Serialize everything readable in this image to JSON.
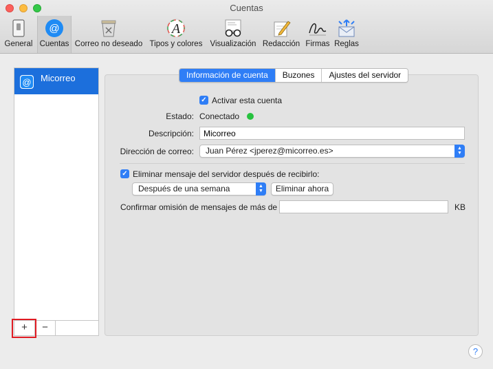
{
  "window": {
    "title": "Cuentas"
  },
  "toolbar": {
    "items": [
      {
        "label": "General",
        "icon": "general-switch-icon"
      },
      {
        "label": "Cuentas",
        "icon": "at-sign-icon"
      },
      {
        "label": "Correo no deseado",
        "icon": "junk-trash-icon"
      },
      {
        "label": "Tipos y colores",
        "icon": "font-a-icon"
      },
      {
        "label": "Visualización",
        "icon": "glasses-icon"
      },
      {
        "label": "Redacción",
        "icon": "pencil-pad-icon"
      },
      {
        "label": "Firmas",
        "icon": "signature-icon"
      },
      {
        "label": "Reglas",
        "icon": "rules-envelope-icon"
      }
    ],
    "active": "Cuentas"
  },
  "sidebar": {
    "accounts": [
      {
        "name": "Micorreo",
        "icon": "at-sign-icon"
      }
    ],
    "add_label": "+",
    "remove_label": "−"
  },
  "tabs": [
    {
      "label": "Información de cuenta",
      "selected": true
    },
    {
      "label": "Buzones",
      "selected": false
    },
    {
      "label": "Ajustes del servidor",
      "selected": false
    }
  ],
  "form": {
    "enable_account": {
      "label": "Activar esta cuenta",
      "checked": true
    },
    "status": {
      "label": "Estado:",
      "value": "Conectado",
      "color": "#27c23f"
    },
    "description": {
      "label": "Descripción:",
      "value": "Micorreo"
    },
    "email": {
      "label": "Dirección de correo:",
      "value": "Juan Pérez <jperez@micorreo.es>"
    },
    "delete_from_server": {
      "label": "Eliminar mensaje del servidor después de recibirlo:",
      "checked": true
    },
    "delete_after": {
      "value": "Después de una semana"
    },
    "delete_now_label": "Eliminar ahora",
    "skip_messages": {
      "label": "Confirmar omisión de mensajes de más de",
      "value": "",
      "unit": "KB"
    }
  },
  "help_label": "?",
  "colors": {
    "accent": "#2f7ef6",
    "selection": "#1c6fdc",
    "highlight": "#e01b23"
  }
}
